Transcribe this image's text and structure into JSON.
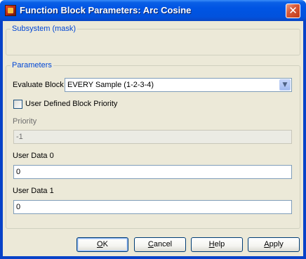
{
  "window": {
    "title": "Function Block Parameters: Arc Cosine",
    "close_glyph": "✕"
  },
  "subsystem": {
    "legend": "Subsystem (mask)"
  },
  "parameters": {
    "legend": "Parameters",
    "evaluate_block": {
      "label": "Evaluate Block",
      "value": "EVERY Sample (1-2-3-4)",
      "arrow_glyph": "▼"
    },
    "priority_checkbox": {
      "label": "User Defined Block Priority",
      "checked": false
    },
    "priority": {
      "label": "Priority",
      "value": "-1"
    },
    "user_data_0": {
      "label": "User Data 0",
      "value": "0"
    },
    "user_data_1": {
      "label": "User Data 1",
      "value": "0"
    }
  },
  "buttons": {
    "ok": {
      "first": "O",
      "rest": "K"
    },
    "cancel": {
      "first": "C",
      "rest": "ancel"
    },
    "help": {
      "first": "H",
      "rest": "elp"
    },
    "apply": {
      "first": "A",
      "rest": "pply"
    }
  },
  "colors": {
    "titlebar": "#0054e3",
    "dialog_background": "#ece9d8",
    "group_legend": "#0046d5"
  },
  "icons": {
    "app": "simulink-block-icon",
    "close": "close-icon",
    "dropdown": "chevron-down-icon"
  }
}
